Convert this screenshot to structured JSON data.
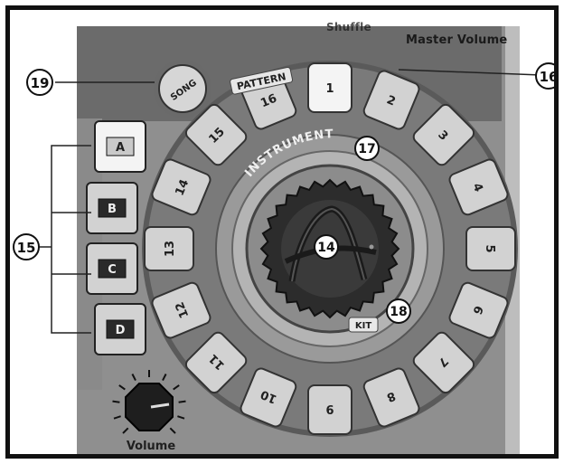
{
  "header": {
    "partial_label": "Shuffle",
    "master_volume_label": "Master Volume"
  },
  "pattern": {
    "label": "PATTERN",
    "buttons": [
      "1",
      "2",
      "3",
      "4",
      "5",
      "6",
      "7",
      "8",
      "9",
      "10",
      "11",
      "12",
      "13",
      "14",
      "15",
      "16"
    ],
    "selected": "1"
  },
  "instrument_label": "INSTRUMENT",
  "kit_label": "KIT",
  "song_button": "SONG",
  "banks": [
    "A",
    "B",
    "C",
    "D"
  ],
  "selected_bank": "A",
  "volume_label": "Volume",
  "callouts": {
    "c14": "14",
    "c15": "15",
    "c16": "16",
    "c17": "17",
    "c18": "18",
    "c19": "19"
  },
  "colors": {
    "button_fill": "#d2d2d2",
    "selected_fill": "#f4f4f4",
    "bank_dark": "#2a2a2a",
    "panel": "#8f8f8f"
  }
}
